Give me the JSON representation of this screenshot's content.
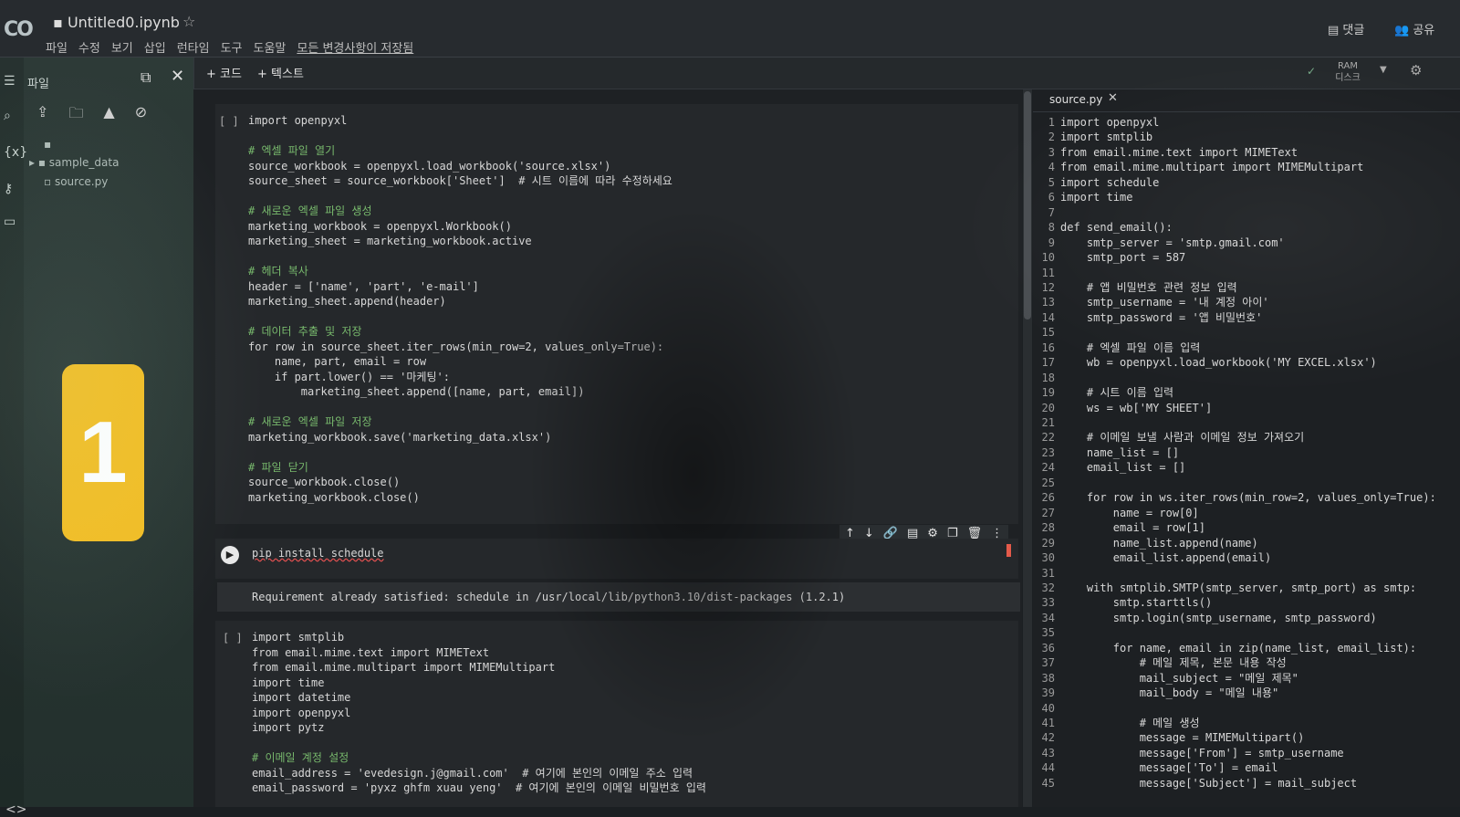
{
  "header": {
    "logo": "CO",
    "notebook_title": "Untitled0.ipynb",
    "star_icon": "☆",
    "menu": [
      "파일",
      "수정",
      "보기",
      "삽입",
      "런타임",
      "도구",
      "도움말"
    ],
    "save_status": "모든 변경사항이 저장됨",
    "comment_label": "댓글",
    "share_label": "공유"
  },
  "toolbar": {
    "add_code": "+ 코드",
    "add_text": "+ 텍스트",
    "ram_label": "RAM",
    "disk_label": "디스크"
  },
  "sidebar": {
    "files_label": "파일",
    "tree": [
      "sample_data",
      "source.py"
    ],
    "badge": "1"
  },
  "cell1": {
    "bracket": "[ ]",
    "lines": [
      "import openpyxl",
      "",
      "# 엑셀 파일 열기",
      "source_workbook = openpyxl.load_workbook('source.xlsx')",
      "source_sheet = source_workbook['Sheet']  # 시트 이름에 따라 수정하세요",
      "",
      "# 새로운 엑셀 파일 생성",
      "marketing_workbook = openpyxl.Workbook()",
      "marketing_sheet = marketing_workbook.active",
      "",
      "# 헤더 복사",
      "header = ['name', 'part', 'e-mail']",
      "marketing_sheet.append(header)",
      "",
      "# 데이터 추출 및 저장",
      "for row in source_sheet.iter_rows(min_row=2, values_only=True):",
      "    name, part, email = row",
      "    if part.lower() == '마케팅':",
      "        marketing_sheet.append([name, part, email])",
      "",
      "# 새로운 엑셀 파일 저장",
      "marketing_workbook.save('marketing_data.xlsx')",
      "",
      "# 파일 닫기",
      "source_workbook.close()",
      "marketing_workbook.close()"
    ]
  },
  "cell2": {
    "command": "pip install schedule",
    "output": "Requirement already satisfied: schedule in /usr/local/lib/python3.10/dist-packages (1.2.1)"
  },
  "cell_toolbar_icons": [
    "↑",
    "↓",
    "🔗",
    "▤",
    "⚙",
    "❐",
    "🗑",
    "⋮"
  ],
  "cell3": {
    "bracket": "[ ]",
    "lines": [
      "import smtplib",
      "from email.mime.text import MIMEText",
      "from email.mime.multipart import MIMEMultipart",
      "import time",
      "import datetime",
      "import openpyxl",
      "import pytz",
      "",
      "# 이메일 계정 설정",
      "email_address = 'evedesign.j@gmail.com'  # 여기에 본인의 이메일 주소 입력",
      "email_password = 'pyxz ghfm xuau yeng'  # 여기에 본인의 이메일 비밀번호 입력"
    ]
  },
  "editor": {
    "tab_name": "source.py",
    "lines": [
      "import openpyxl",
      "import smtplib",
      "from email.mime.text import MIMEText",
      "from email.mime.multipart import MIMEMultipart",
      "import schedule",
      "import time",
      "",
      "def send_email():",
      "    smtp_server = 'smtp.gmail.com'",
      "    smtp_port = 587",
      "",
      "    # 앱 비밀번호 관련 정보 입력",
      "    smtp_username = '내 계정 아이'",
      "    smtp_password = '앱 비밀번호'",
      "",
      "    # 엑셀 파일 이름 입력",
      "    wb = openpyxl.load_workbook('MY EXCEL.xlsx')",
      "",
      "    # 시트 이름 입력",
      "    ws = wb['MY SHEET']",
      "",
      "    # 이메일 보낼 사람과 이메일 정보 가져오기",
      "    name_list = []",
      "    email_list = []",
      "",
      "    for row in ws.iter_rows(min_row=2, values_only=True):",
      "        name = row[0]",
      "        email = row[1]",
      "        name_list.append(name)",
      "        email_list.append(email)",
      "",
      "    with smtplib.SMTP(smtp_server, smtp_port) as smtp:",
      "        smtp.starttls()",
      "        smtp.login(smtp_username, smtp_password)",
      "",
      "        for name, email in zip(name_list, email_list):",
      "            # 메일 제목, 본문 내용 작성",
      "            mail_subject = \"메일 제목\"",
      "            mail_body = \"메일 내용\"",
      "",
      "            # 메일 생성",
      "            message = MIMEMultipart()",
      "            message['From'] = smtp_username",
      "            message['To'] = email",
      "            message['Subject'] = mail_subject"
    ]
  }
}
